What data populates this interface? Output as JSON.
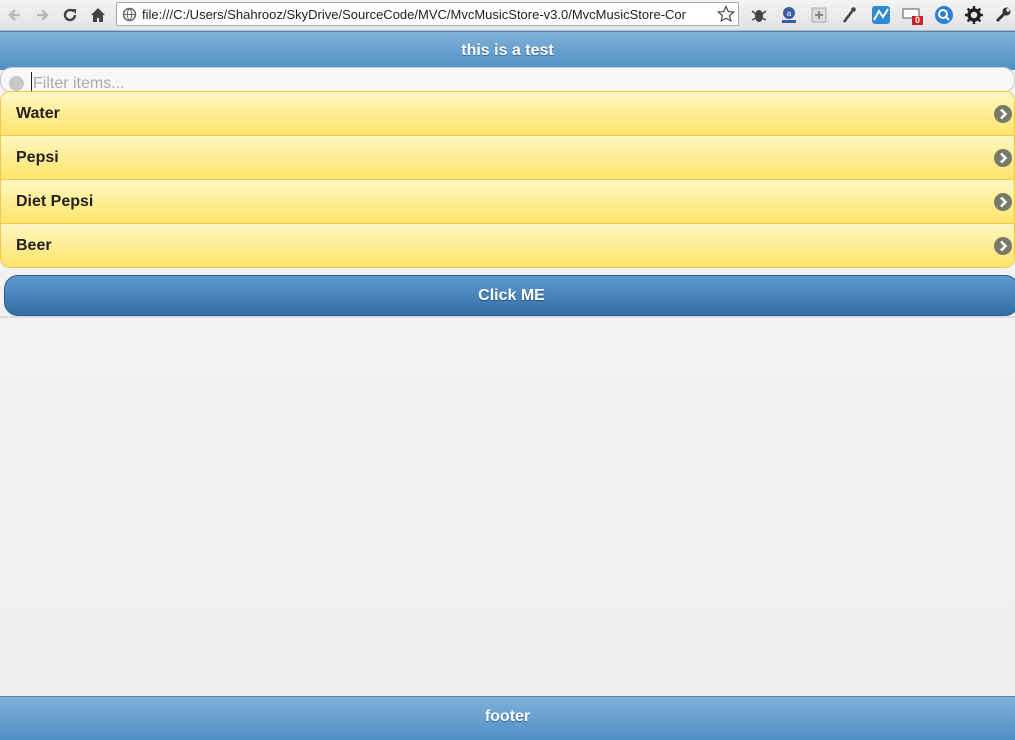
{
  "browser": {
    "url": "file:///C:/Users/Shahrooz/SkyDrive/SourceCode/MVC/MvcMusicStore-v3.0/MvcMusicStore-Cor",
    "badge_count": "0",
    "icons": [
      "back-arrow-icon",
      "forward-arrow-icon",
      "reload-icon",
      "home-icon",
      "globe-icon",
      "star-icon",
      "bug-icon",
      "extension-icon",
      "plus-box-icon",
      "eyedropper-icon",
      "map-icon",
      "window-icon",
      "search-icon",
      "gear-icon",
      "wrench-icon"
    ]
  },
  "header": {
    "title": "this is a test"
  },
  "search": {
    "placeholder": "Filter items..."
  },
  "list": {
    "items": [
      {
        "label": "Water"
      },
      {
        "label": "Pepsi"
      },
      {
        "label": "Diet Pepsi"
      },
      {
        "label": "Beer"
      }
    ]
  },
  "button": {
    "label": "Click ME"
  },
  "footer": {
    "text": "footer"
  },
  "colors": {
    "header_blue": "#5a99cd",
    "list_yellow": "#ffe46a",
    "button_blue": "#3f78b0"
  }
}
